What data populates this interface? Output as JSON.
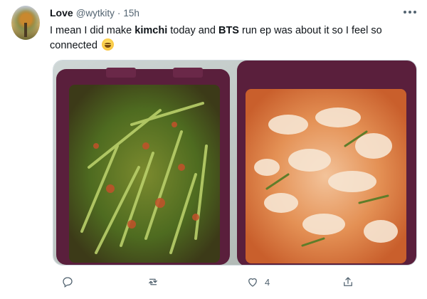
{
  "tweet": {
    "display_name": "Love",
    "handle": "@wytkity",
    "separator": "·",
    "timestamp": "15h",
    "text_part_1": "I mean I did make ",
    "bold_1": "kimchi",
    "text_part_2": " today and ",
    "bold_2": "BTS",
    "text_part_3": " run ep was about it so I feel so connected",
    "emoji": "grinning-sweat-emoji",
    "media": {
      "left_container": "green-onion-kimchi",
      "right_container": "napa-cabbage-kimchi",
      "container_color": "#5a1f3c"
    },
    "actions": {
      "reply_count": "",
      "retweet_count": "",
      "like_count": "4",
      "share_count": ""
    }
  },
  "colors": {
    "text": "#0f1419",
    "secondary": "#536471",
    "border": "#cfd9de"
  }
}
